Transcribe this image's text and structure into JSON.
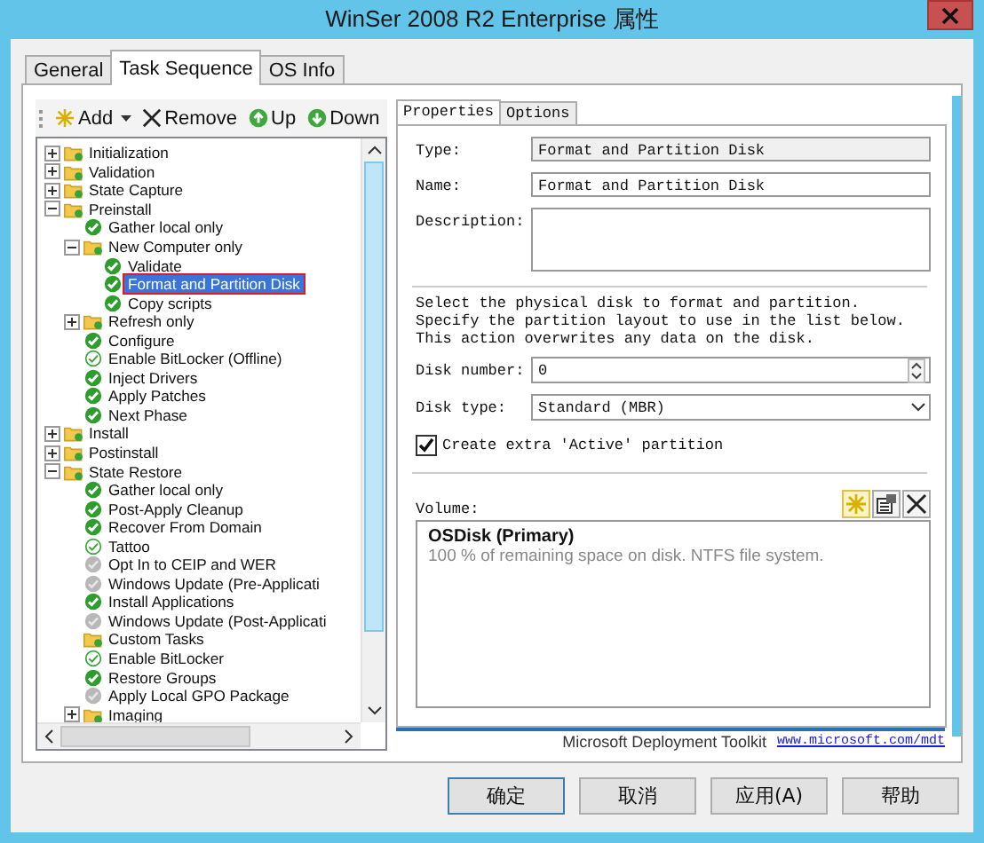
{
  "window": {
    "title": "WinSer 2008 R2 Enterprise 属性"
  },
  "tabs": [
    {
      "label": "General",
      "selected": false
    },
    {
      "label": "Task Sequence",
      "selected": true
    },
    {
      "label": "OS Info",
      "selected": false
    }
  ],
  "toolbar": [
    {
      "label": "Add",
      "kind": "add",
      "dropdown": true
    },
    {
      "label": "Remove",
      "kind": "remove",
      "dropdown": false
    },
    {
      "label": "Up",
      "kind": "up",
      "dropdown": false
    },
    {
      "label": "Down",
      "kind": "down",
      "dropdown": false
    }
  ],
  "task_tree": [
    {
      "label": "Initialization",
      "kind": "folder",
      "expanded": false,
      "selected": false
    },
    {
      "label": "Validation",
      "kind": "folder",
      "expanded": false,
      "selected": false
    },
    {
      "label": "State Capture",
      "kind": "folder",
      "expanded": false,
      "selected": false
    },
    {
      "label": "Preinstall",
      "kind": "folder",
      "expanded": true,
      "selected": false,
      "children": [
        {
          "label": "Gather local only",
          "kind": "step",
          "enabled": true,
          "conditional": false,
          "selected": false
        },
        {
          "label": "New Computer only",
          "kind": "folder",
          "expanded": true,
          "selected": false,
          "children": [
            {
              "label": "Validate",
              "kind": "step",
              "enabled": true,
              "conditional": false,
              "selected": false
            },
            {
              "label": "Format and Partition Disk",
              "kind": "step",
              "enabled": true,
              "conditional": false,
              "selected": true
            },
            {
              "label": "Copy scripts",
              "kind": "step",
              "enabled": true,
              "conditional": false,
              "selected": false
            }
          ]
        },
        {
          "label": "Refresh only",
          "kind": "folder",
          "expanded": false,
          "selected": false
        },
        {
          "label": "Configure",
          "kind": "step",
          "enabled": true,
          "conditional": false,
          "selected": false
        },
        {
          "label": "Enable BitLocker (Offline)",
          "kind": "step",
          "enabled": true,
          "conditional": true,
          "selected": false
        },
        {
          "label": "Inject Drivers",
          "kind": "step",
          "enabled": true,
          "conditional": false,
          "selected": false
        },
        {
          "label": "Apply Patches",
          "kind": "step",
          "enabled": true,
          "conditional": false,
          "selected": false
        },
        {
          "label": "Next Phase",
          "kind": "step",
          "enabled": true,
          "conditional": false,
          "selected": false
        }
      ]
    },
    {
      "label": "Install",
      "kind": "folder",
      "expanded": false,
      "selected": false
    },
    {
      "label": "Postinstall",
      "kind": "folder",
      "expanded": false,
      "selected": false
    },
    {
      "label": "State Restore",
      "kind": "folder",
      "expanded": true,
      "selected": false,
      "children": [
        {
          "label": "Gather local only",
          "kind": "step",
          "enabled": true,
          "conditional": false,
          "selected": false
        },
        {
          "label": "Post-Apply Cleanup",
          "kind": "step",
          "enabled": true,
          "conditional": false,
          "selected": false
        },
        {
          "label": "Recover From Domain",
          "kind": "step",
          "enabled": true,
          "conditional": false,
          "selected": false
        },
        {
          "label": "Tattoo",
          "kind": "step",
          "enabled": true,
          "conditional": true,
          "selected": false
        },
        {
          "label": "Opt In to CEIP and WER",
          "kind": "step",
          "enabled": false,
          "conditional": false,
          "selected": false
        },
        {
          "label": "Windows Update (Pre-Applicati",
          "kind": "step",
          "enabled": false,
          "conditional": false,
          "selected": false
        },
        {
          "label": "Install Applications",
          "kind": "step",
          "enabled": true,
          "conditional": false,
          "selected": false
        },
        {
          "label": "Windows Update (Post-Applicati",
          "kind": "step",
          "enabled": false,
          "conditional": false,
          "selected": false
        },
        {
          "label": "Custom Tasks",
          "kind": "folder",
          "selected": false
        },
        {
          "label": "Enable BitLocker",
          "kind": "step",
          "enabled": true,
          "conditional": true,
          "selected": false
        },
        {
          "label": "Restore Groups",
          "kind": "step",
          "enabled": true,
          "conditional": false,
          "selected": false
        },
        {
          "label": "Apply Local GPO Package",
          "kind": "step",
          "enabled": false,
          "conditional": false,
          "selected": false
        },
        {
          "label": "Imaging",
          "kind": "folder",
          "expanded": false,
          "selected": false
        }
      ]
    }
  ],
  "subtabs": [
    {
      "label": "Properties",
      "selected": true
    },
    {
      "label": "Options",
      "selected": false
    }
  ],
  "properties": {
    "fields": [
      {
        "label": "Type:",
        "value": "Format and Partition Disk",
        "kind": "readonly"
      },
      {
        "label": "Name:",
        "value": "Format and Partition Disk",
        "kind": "text"
      },
      {
        "label": "Description:",
        "kind": "textarea"
      }
    ],
    "instructions": "Select the physical disk to format and partition.  Specify the partition layout to use in the list below. This action overwrites any data on the disk.",
    "disk_number": {
      "label": "Disk number:",
      "value": "0"
    },
    "disk_type": {
      "label": "Disk type:",
      "value": "Standard (MBR)"
    },
    "active_partition": {
      "label": "Create extra 'Active' partition",
      "checked": true
    },
    "volume": {
      "label": "Volume:",
      "items": [
        {
          "name": "OSDisk (Primary)",
          "detail": "100 % of remaining space on disk. NTFS file system."
        }
      ]
    }
  },
  "footer": {
    "text": "Microsoft Deployment Toolkit",
    "link": "www.microsoft.com/mdt"
  },
  "buttons": [
    {
      "label": "确定",
      "default": true
    },
    {
      "label": "取消",
      "default": false
    },
    {
      "label": "应用(A)",
      "default": false
    },
    {
      "label": "帮助",
      "default": false
    }
  ]
}
